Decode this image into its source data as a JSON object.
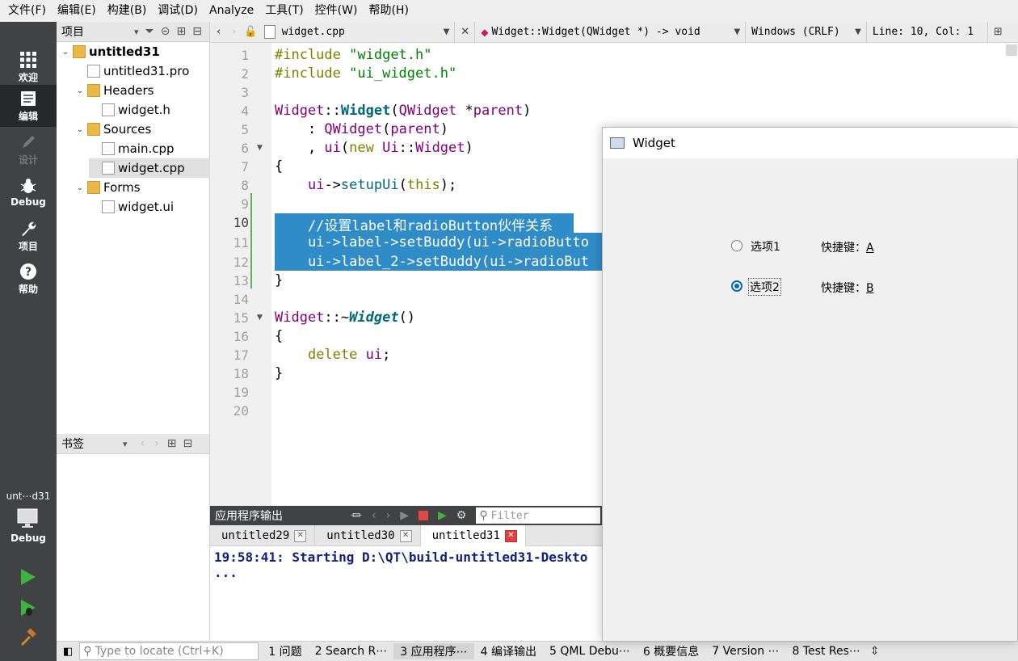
{
  "menu": [
    "文件(F)",
    "编辑(E)",
    "构建(B)",
    "调试(D)",
    "Analyze",
    "工具(T)",
    "控件(W)",
    "帮助(H)"
  ],
  "modes": [
    {
      "label": "欢迎",
      "icon": "grid-icon"
    },
    {
      "label": "编辑",
      "icon": "edit-icon"
    },
    {
      "label": "设计",
      "icon": "pencil-icon"
    },
    {
      "label": "Debug",
      "icon": "bug-icon"
    },
    {
      "label": "项目",
      "icon": "wrench-icon"
    },
    {
      "label": "帮助",
      "icon": "help-icon"
    }
  ],
  "kit": {
    "project": "unt⋯d31",
    "config": "Debug"
  },
  "project_pane": {
    "title": "项目",
    "tree": [
      {
        "label": "untitled31",
        "level": 0,
        "expanded": true,
        "icon": "project-folder-icon",
        "bold": true
      },
      {
        "label": "untitled31.pro",
        "level": 1,
        "icon": "pro-file-icon"
      },
      {
        "label": "Headers",
        "level": 1,
        "expanded": true,
        "icon": "headers-folder-icon"
      },
      {
        "label": "widget.h",
        "level": 2,
        "icon": "h-file-icon"
      },
      {
        "label": "Sources",
        "level": 1,
        "expanded": true,
        "icon": "sources-folder-icon"
      },
      {
        "label": "main.cpp",
        "level": 2,
        "icon": "cpp-file-icon"
      },
      {
        "label": "widget.cpp",
        "level": 2,
        "icon": "cpp-file-icon",
        "selected": true
      },
      {
        "label": "Forms",
        "level": 1,
        "expanded": true,
        "icon": "forms-folder-icon"
      },
      {
        "label": "widget.ui",
        "level": 2,
        "icon": "ui-file-icon"
      }
    ]
  },
  "bookmarks_pane": {
    "title": "书签"
  },
  "editor_toolbar": {
    "file": "widget.cpp",
    "symbol": "Widget::Widget(QWidget *) -> void",
    "encoding": "Windows (CRLF)",
    "position": "Line: 10, Col: 1"
  },
  "editor": {
    "current_line": 10,
    "line_numbers": [
      "1",
      "2",
      "3",
      "4",
      "5",
      "6",
      "7",
      "8",
      "9",
      "10",
      "11",
      "12",
      "13",
      "14",
      "15",
      "16",
      "17",
      "18",
      "19",
      "20"
    ]
  },
  "output_pane": {
    "title": "应用程序输出",
    "filter_placeholder": "Filter",
    "tabs": [
      "untitled29",
      "untitled30",
      "untitled31"
    ],
    "active_tab": "untitled31",
    "lines": [
      "19:58:41: Starting D:\\QT\\build-untitled31-Deskto",
      "..."
    ]
  },
  "statusbar": {
    "locate_placeholder": "Type to locate (Ctrl+K)",
    "items": [
      "1 问题",
      "2 Search R⋯",
      "3 应用程序⋯",
      "4 编译输出",
      "5 QML Debu⋯",
      "6 概要信息",
      "7 Version ⋯",
      "8 Test Res⋯"
    ]
  },
  "widget_window": {
    "title": "Widget",
    "options": [
      {
        "label": "选项1",
        "shortcut_label": "快捷键：",
        "shortcut_key": "A",
        "checked": false
      },
      {
        "label": "选项2",
        "shortcut_label": "快捷键：",
        "shortcut_key": "B",
        "checked": true
      }
    ]
  },
  "colors": {
    "selection": "#308cc6",
    "sidebar": "#404244",
    "accent": "#0067c0"
  }
}
